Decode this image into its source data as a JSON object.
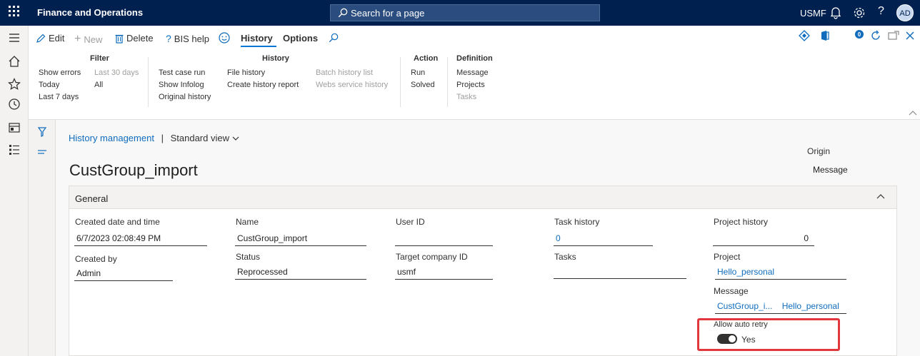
{
  "topbar": {
    "app_name": "Finance and Operations",
    "search_placeholder": "Search for a page",
    "company": "USMF",
    "avatar_initials": "AD"
  },
  "toolbar": {
    "edit": "Edit",
    "new": "New",
    "delete": "Delete",
    "bis_help": "BIS help",
    "history_tab": "History",
    "options_tab": "Options"
  },
  "ribbon": {
    "filter": {
      "header": "Filter",
      "show_errors": "Show errors",
      "last_30_days": "Last 30 days",
      "today": "Today",
      "all": "All",
      "last_7_days": "Last 7 days"
    },
    "history": {
      "header": "History",
      "test_case_run": "Test case run",
      "show_infolog": "Show Infolog",
      "original_history": "Original history",
      "file_history": "File history",
      "create_history_report": "Create history report",
      "batch_history_list": "Batch history list",
      "webs_service_history": "Webs service history"
    },
    "action": {
      "header": "Action",
      "run": "Run",
      "solved": "Solved"
    },
    "definition": {
      "header": "Definition",
      "message": "Message",
      "projects": "Projects",
      "tasks": "Tasks"
    }
  },
  "page": {
    "breadcrumb_link": "History management",
    "breadcrumb_sep": "|",
    "view_name": "Standard view",
    "title": "CustGroup_import",
    "origin_label": "Origin",
    "origin_value": "Message"
  },
  "general": {
    "header": "General",
    "created_datetime_label": "Created date and time",
    "created_datetime_value": "6/7/2023 02:08:49 PM",
    "created_by_label": "Created by",
    "created_by_value": "Admin",
    "name_label": "Name",
    "name_value": "CustGroup_import",
    "status_label": "Status",
    "status_value": "Reprocessed",
    "user_id_label": "User ID",
    "user_id_value": "",
    "target_company_label": "Target company ID",
    "target_company_value": "usmf",
    "task_history_label": "Task history",
    "task_history_value": "0",
    "tasks_label": "Tasks",
    "tasks_value": "",
    "project_history_label": "Project history",
    "project_history_value": "0",
    "project_label": "Project",
    "project_value": "Hello_personal",
    "message_label": "Message",
    "message_value_1": "CustGroup_i...",
    "message_value_2": "Hello_personal",
    "auto_retry_label": "Allow auto retry",
    "auto_retry_value": "Yes"
  },
  "colors": {
    "topbar": "#002050",
    "link": "#0f6cbd",
    "accent": "#0078d4",
    "highlight": "#e0383c"
  }
}
